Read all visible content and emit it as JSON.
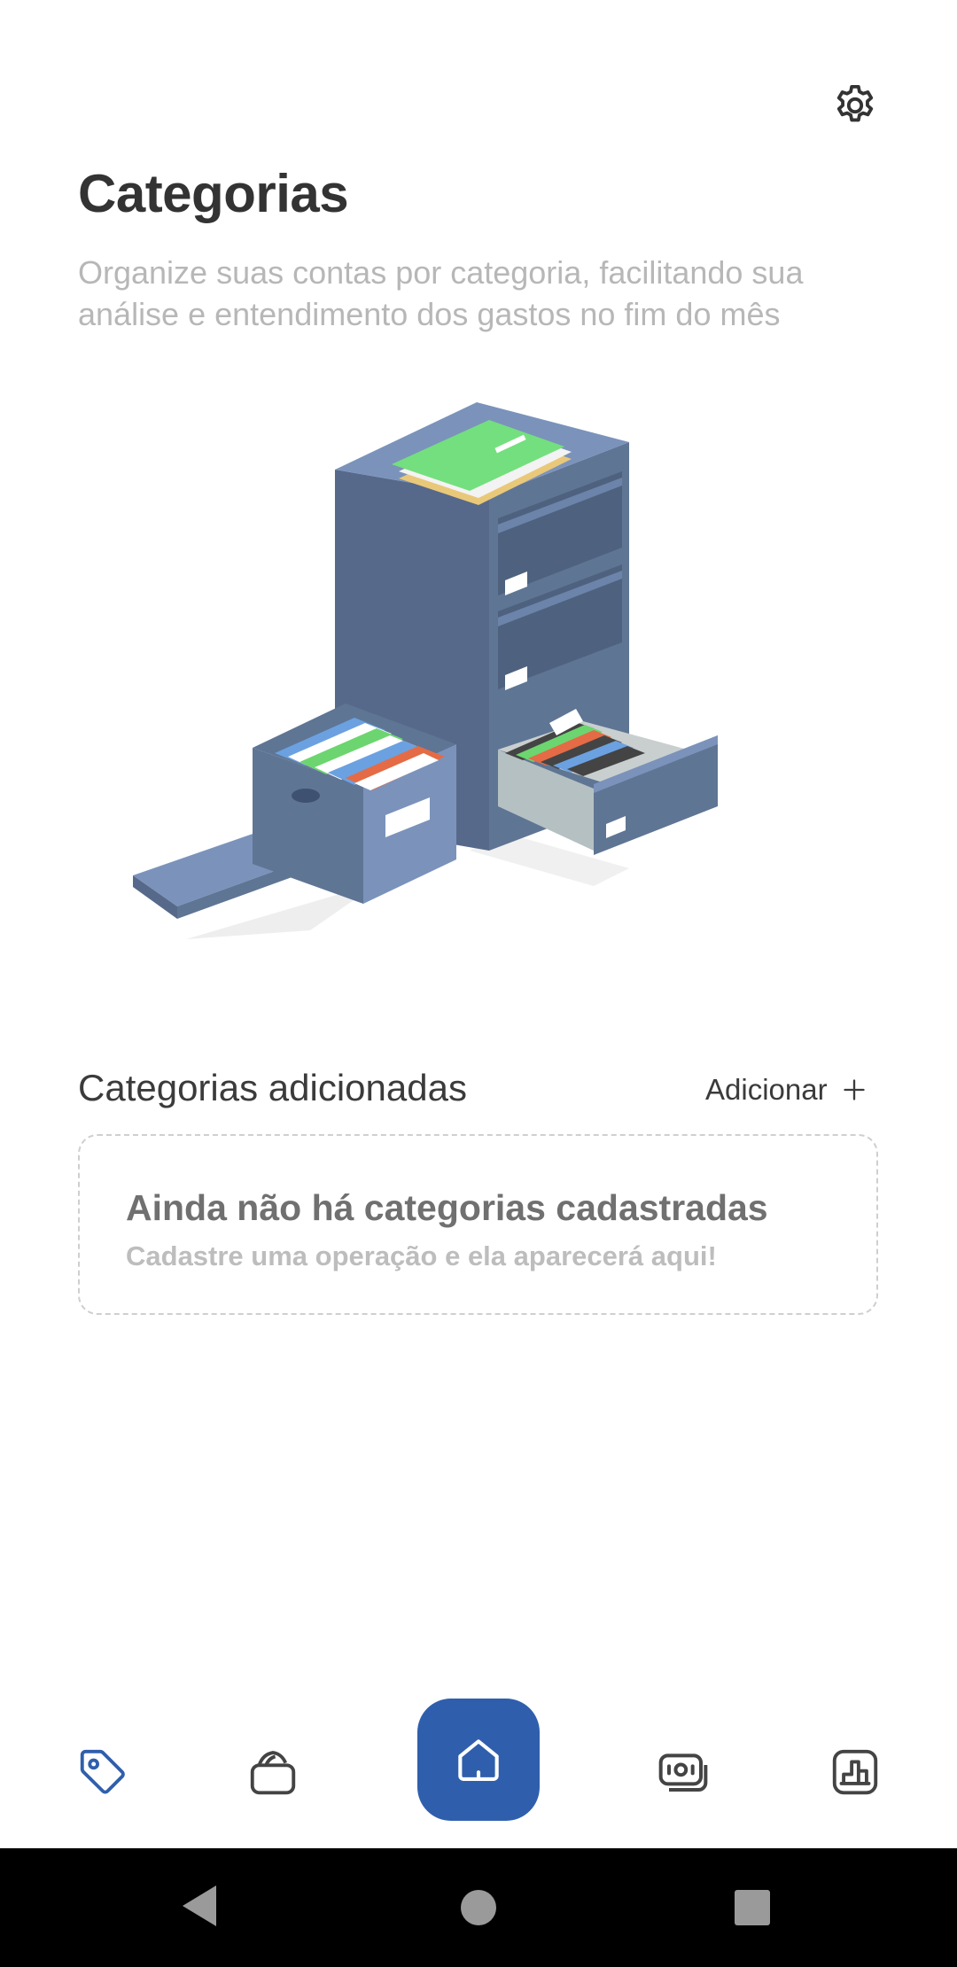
{
  "header": {
    "title": "Categorias",
    "subtitle": "Organize suas contas por categoria, facilitando sua análise e entendimento dos gastos no fim do mês",
    "settings_icon": "gear-icon"
  },
  "section": {
    "title": "Categorias adicionadas",
    "add_label": "Adicionar",
    "add_icon": "plus-icon"
  },
  "empty_state": {
    "title": "Ainda não há categorias cadastradas",
    "description": "Cadastre uma operação e ela aparecerá aqui!"
  },
  "bottom_nav": {
    "items": [
      {
        "icon": "tag-icon",
        "active": true
      },
      {
        "icon": "wallet-icon",
        "active": false
      },
      {
        "icon": "home-icon",
        "active": false
      },
      {
        "icon": "money-icon",
        "active": false
      },
      {
        "icon": "bar-chart-icon",
        "active": false
      }
    ]
  },
  "system_nav": {
    "buttons": [
      "back-icon",
      "home-circle-icon",
      "recents-icon"
    ]
  },
  "colors": {
    "accent": "#2f5fac",
    "title": "#333333",
    "subtitle": "#b7b7b7",
    "cabinet": "#5f7594",
    "system_bar": "#000000"
  }
}
